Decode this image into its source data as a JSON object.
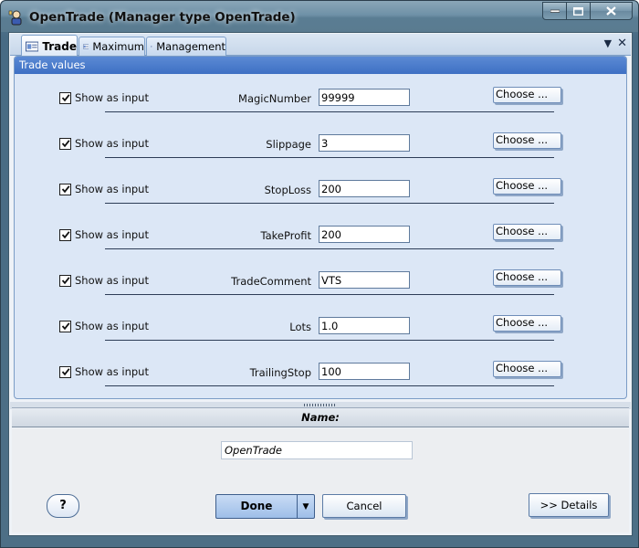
{
  "window": {
    "title": "OpenTrade (Manager type OpenTrade)",
    "app_icon": "trader-icon",
    "caption_buttons": [
      "minimize",
      "maximize",
      "close"
    ]
  },
  "tabs": [
    {
      "label": "Trade",
      "active": true
    },
    {
      "label": "Maximum",
      "active": false
    },
    {
      "label": "Management",
      "active": false
    }
  ],
  "group": {
    "title": "Trade values",
    "show_input_label": "Show as input",
    "choose_label": "Choose ...",
    "rows": [
      {
        "label": "MagicNumber",
        "value": "99999",
        "checked": true
      },
      {
        "label": "Slippage",
        "value": "3",
        "checked": true
      },
      {
        "label": "StopLoss",
        "value": "200",
        "checked": true
      },
      {
        "label": "TakeProfit",
        "value": "200",
        "checked": true
      },
      {
        "label": "TradeComment",
        "value": "VTS",
        "checked": true
      },
      {
        "label": "Lots",
        "value": "1.0",
        "checked": true
      },
      {
        "label": "TrailingStop",
        "value": "100",
        "checked": true
      }
    ]
  },
  "name_section": {
    "header": "Name:",
    "value": "OpenTrade"
  },
  "buttons": {
    "help": "?",
    "done": "Done",
    "cancel": "Cancel",
    "details": ">> Details"
  }
}
